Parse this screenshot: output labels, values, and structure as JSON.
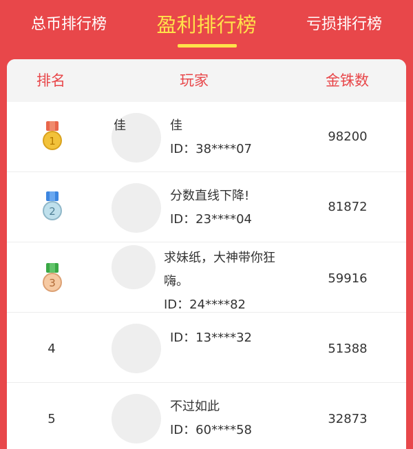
{
  "tabs": {
    "left": "总币排行榜",
    "active": "盈利排行榜",
    "right": "亏损排行榜"
  },
  "header": {
    "rank": "排名",
    "player": "玩家",
    "coins": "金铢数"
  },
  "rows": [
    {
      "rank": "1",
      "medal_color": "#f2c23a",
      "ribbon_color": "#e8664b",
      "name": "佳",
      "name_overflow": "佳",
      "id": "ID：38****07",
      "coins": "98200"
    },
    {
      "rank": "2",
      "medal_color": "#bfe0ec",
      "ribbon_color": "#3d86e0",
      "name": "分数直线下降!",
      "id": "ID：23****04",
      "coins": "81872"
    },
    {
      "rank": "3",
      "medal_color": "#f6c9a2",
      "ribbon_color": "#3aa845",
      "name_line1": "求妹纸，大神带你狂",
      "name_line2": "嗨。",
      "id": "ID：24****82",
      "coins": "59916"
    },
    {
      "rank": "4",
      "id": "ID：13****32",
      "coins": "51388"
    },
    {
      "rank": "5",
      "name": "不过如此",
      "id": "ID：60****58",
      "coins": "32873"
    }
  ]
}
